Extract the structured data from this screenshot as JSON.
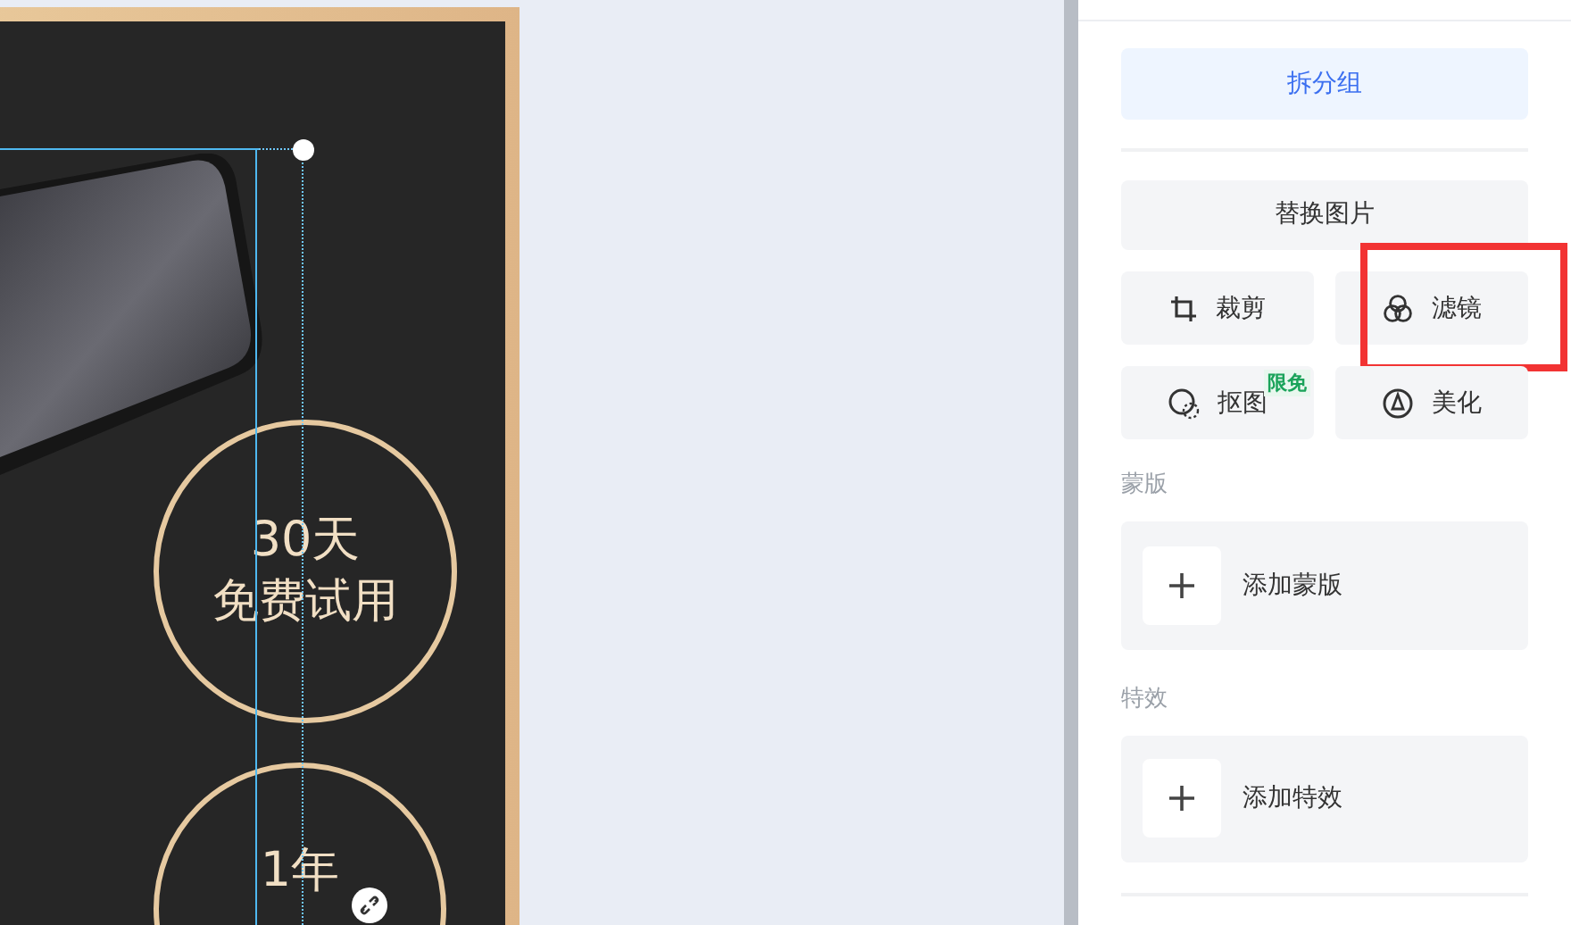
{
  "canvas": {
    "badges": [
      {
        "lines": [
          "30天",
          "免费试用"
        ]
      },
      {
        "lines": [
          "1年"
        ]
      }
    ]
  },
  "panel": {
    "split_button": "拆分组",
    "replace_button": "替换图片",
    "tools": [
      {
        "label": "裁剪",
        "kind": "crop",
        "highlighted": false
      },
      {
        "label": "滤镜",
        "kind": "filter",
        "highlighted": true
      },
      {
        "label": "抠图",
        "kind": "cutout",
        "highlighted": false,
        "badge": "限免"
      },
      {
        "label": "美化",
        "kind": "beautify",
        "highlighted": false
      }
    ],
    "sections": [
      {
        "title": "蒙版",
        "add_label": "添加蒙版"
      },
      {
        "title": "特效",
        "add_label": "添加特效"
      }
    ]
  }
}
